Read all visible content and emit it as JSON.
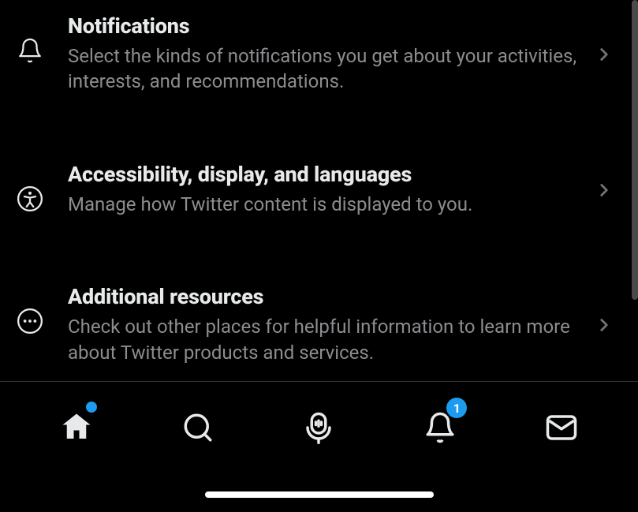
{
  "settings": {
    "items": [
      {
        "title": "Notifications",
        "desc": "Select the kinds of notifications you get about your activities, interests, and recommendations."
      },
      {
        "title": "Accessibility, display, and languages",
        "desc": "Manage how Twitter content is displayed to you."
      },
      {
        "title": "Additional resources",
        "desc": "Check out other places for helpful information to learn more about Twitter products and services."
      }
    ]
  },
  "tabbar": {
    "notification_count": "1"
  }
}
